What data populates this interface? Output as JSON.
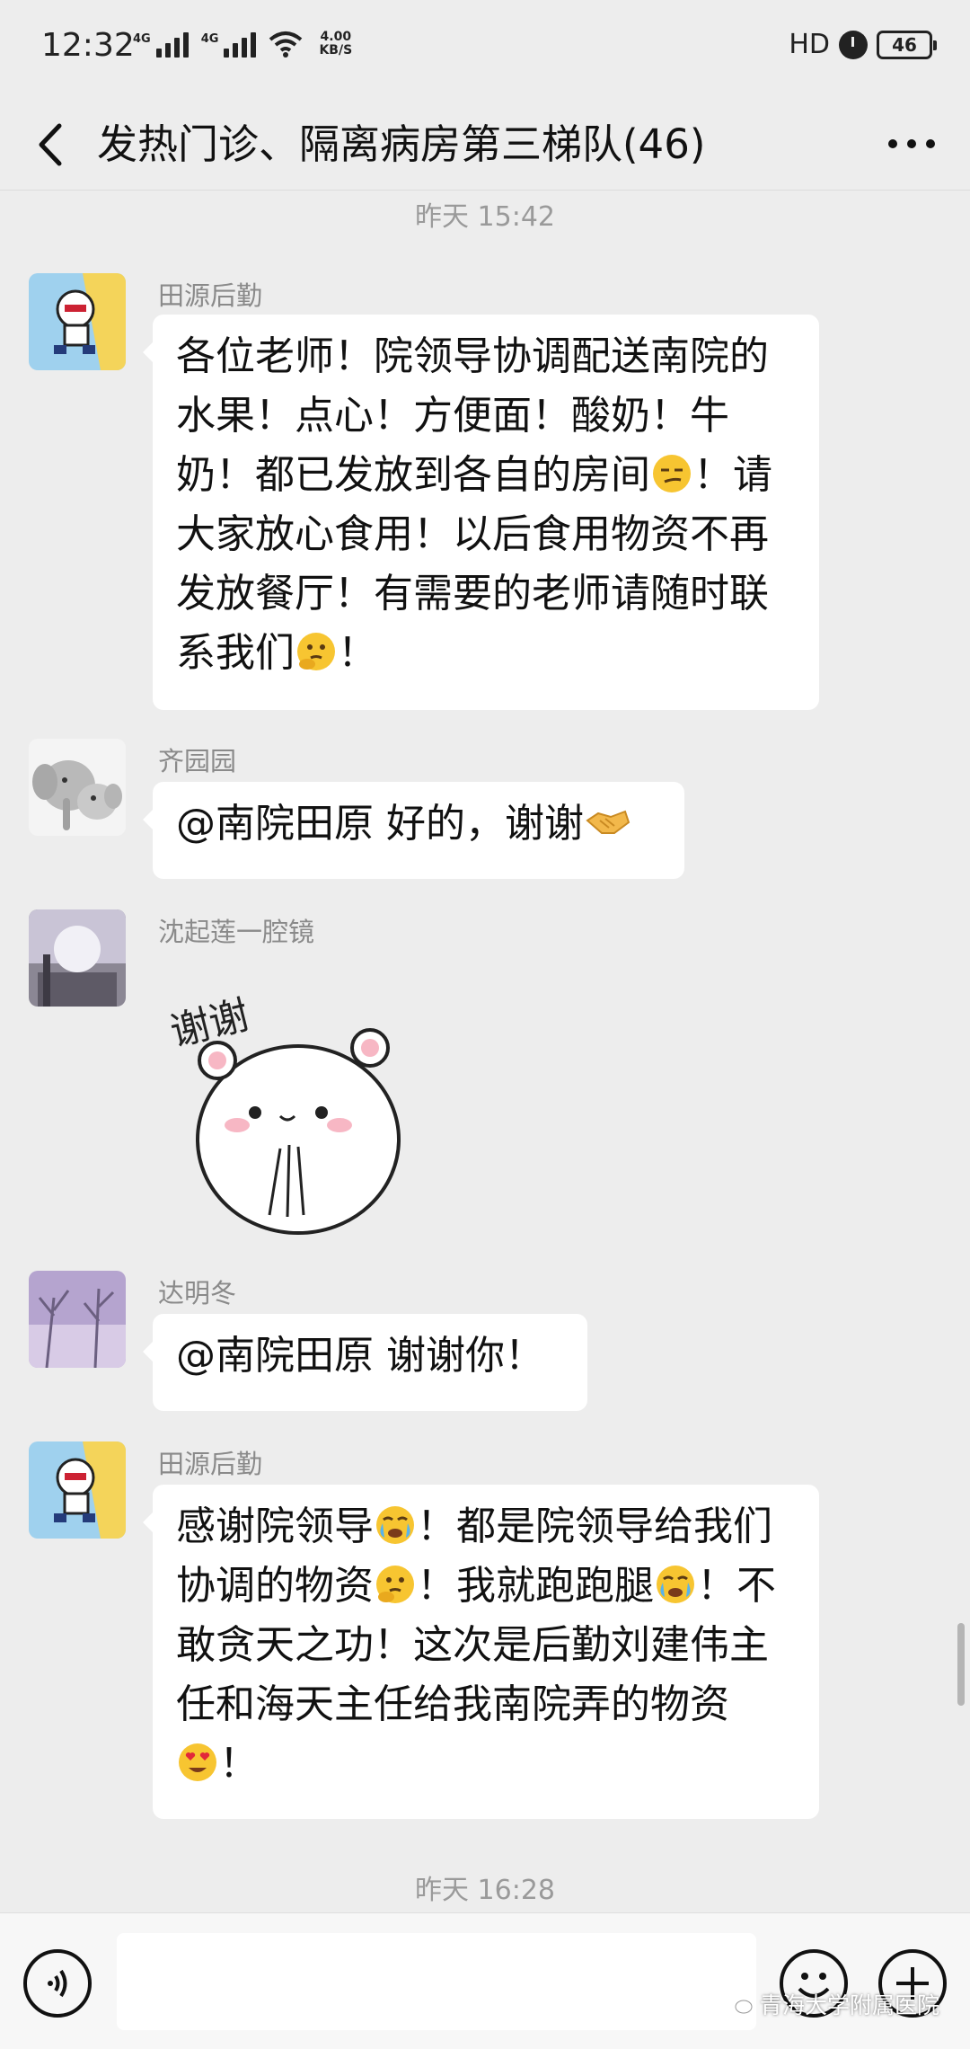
{
  "status_bar": {
    "time": "12:32",
    "signal_1": "4G",
    "signal_2": "4G",
    "net_speed_value": "4.00",
    "net_speed_unit": "KB/S",
    "hd": "HD",
    "battery": "46"
  },
  "header": {
    "title": "发热门诊、隔离病房第三梯队(46)"
  },
  "messages": [
    {
      "time": "昨天 15:42",
      "sender": "田源后勤",
      "parts": [
        "各位老师！院领导协调配送南院的",
        "水果！点心！方便面！酸奶！牛",
        "奶！都已发放到各自的房间",
        "！请",
        "大家放心食用！以后食用物资不再",
        "发放餐厅！有需要的老师请随时联",
        "系我们",
        "！"
      ]
    },
    {
      "sender": "齐园园",
      "parts": [
        "@南院田原  好的，谢谢"
      ]
    },
    {
      "sender": "沈起莲一腔镜",
      "sticker_text": "谢谢"
    },
    {
      "sender": "达明冬",
      "parts": [
        "@南院田原  谢谢你！"
      ]
    },
    {
      "sender": "田源后勤",
      "parts": [
        "感谢院领导",
        "！都是院领导给我们",
        "协调的物资",
        "！我就跑跑腿",
        "！不",
        "敢贪天之功！这次是后勤刘建伟主",
        "任和海天主任给我南院弄的物资",
        "！"
      ]
    }
  ],
  "next_time": "昨天 16:28",
  "watermark": "青海大学附属医院",
  "colors": {
    "background": "#ededed",
    "bubble": "#ffffff",
    "timestamp": "#9a9a9a",
    "sender": "#8a8a8a"
  },
  "icons": [
    "back-arrow-icon",
    "more-icon",
    "voice-icon",
    "emoji-icon",
    "plus-icon",
    "wechat-icon"
  ]
}
